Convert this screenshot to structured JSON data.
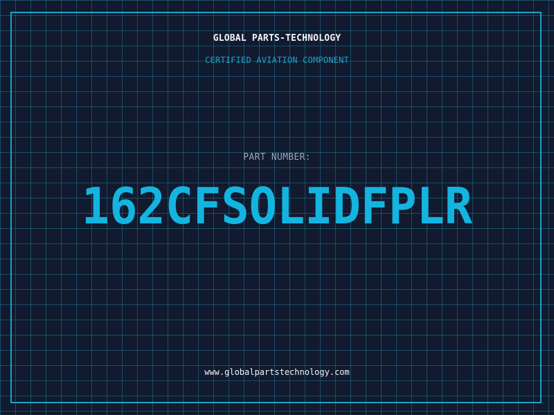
{
  "header": {
    "company": "GLOBAL PARTS-TECHNOLOGY",
    "subtitle": "CERTIFIED AVIATION COMPONENT"
  },
  "part": {
    "label": "PART NUMBER:",
    "number": "162CFSOLIDFPLR"
  },
  "footer": {
    "website": "www.globalpartstechnology.com"
  },
  "colors": {
    "background": "#111a2e",
    "grid": "#1e7896",
    "accent": "#14b4e0",
    "text": "#f2f5f8",
    "label": "#9aa6b8"
  }
}
